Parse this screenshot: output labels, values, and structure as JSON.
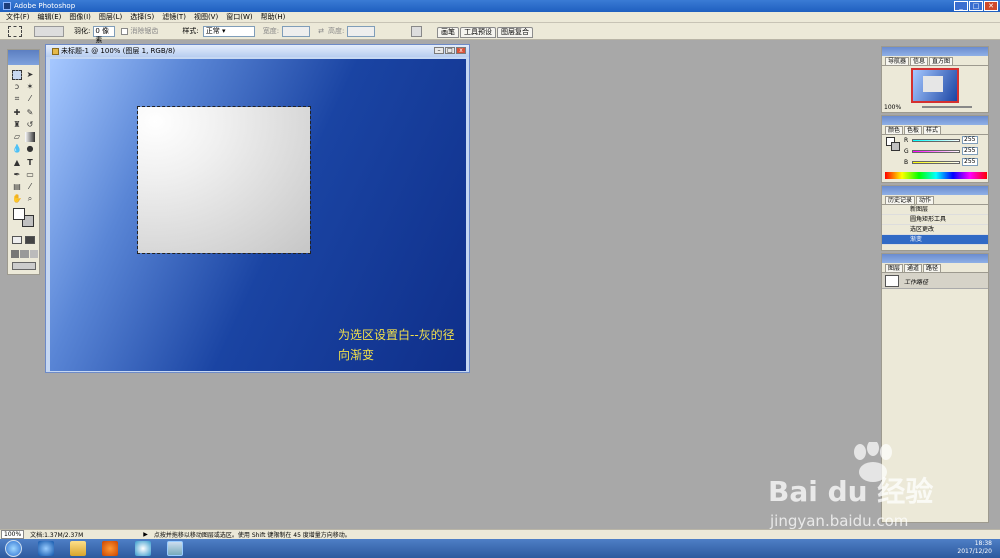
{
  "app": {
    "title": "Adobe Photoshop"
  },
  "menu": [
    "文件(F)",
    "编辑(E)",
    "图像(I)",
    "图层(L)",
    "选择(S)",
    "滤镜(T)",
    "视图(V)",
    "窗口(W)",
    "帮助(H)"
  ],
  "options": {
    "feather_label": "羽化:",
    "feather_value": "0 像素",
    "antialias_label": "消除锯齿",
    "style_label": "样式:",
    "style_value": "正常",
    "width_label": "宽度:",
    "height_label": "高度:"
  },
  "palette_well": [
    "画笔",
    "工具预设",
    "图层复合"
  ],
  "document": {
    "title": "未标题-1 @ 100% (图层 1, RGB/8)",
    "caption_line1": "为选区设置白--灰的径",
    "caption_line2": "向渐变"
  },
  "navigator": {
    "tabs": [
      "导航器",
      "信息",
      "直方图"
    ],
    "zoom": "100%"
  },
  "color": {
    "tabs": [
      "颜色",
      "色板",
      "样式"
    ],
    "r_label": "R",
    "g_label": "G",
    "b_label": "B",
    "r": "255",
    "g": "255",
    "b": "255"
  },
  "history": {
    "tabs": [
      "历史记录",
      "动作"
    ],
    "items": [
      "新图层",
      "圆角矩形工具",
      "选区更改",
      "渐变"
    ]
  },
  "layers": {
    "tabs": [
      "图层",
      "通道",
      "路径"
    ],
    "work_path": "工作路径"
  },
  "status": {
    "zoom": "100%",
    "doc_size": "文档:1.37M/2.37M",
    "hint": "点按并拖移以移动图层或选区。使用 Shift 键限制在 45 度增量方向移动。"
  },
  "clock": {
    "time": "18:38",
    "date": "2017/12/20"
  },
  "watermark": {
    "logo_text": "Bai du 经验",
    "url": "jingyan.baidu.com"
  },
  "colors": {
    "canvas_dark": "#0f2f8a",
    "canvas_light": "#a6c8ff",
    "caption": "#f3e14a",
    "workspace": "#a8a8a8"
  }
}
